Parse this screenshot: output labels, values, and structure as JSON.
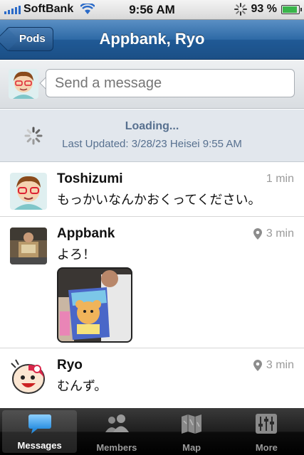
{
  "status_bar": {
    "carrier": "SoftBank",
    "time": "9:56 AM",
    "battery": "93 %",
    "battery_level": 0.93
  },
  "nav": {
    "back_label": "Pods",
    "title": "Appbank, Ryo"
  },
  "compose": {
    "placeholder": "Send a message"
  },
  "loading": {
    "title": "Loading...",
    "last_updated": "Last Updated: 3/28/23 Heisei 9:55 AM"
  },
  "feed": [
    {
      "name": "Toshizumi",
      "time": "1 min",
      "text": "もっかいなんかおくってください。",
      "has_location": false,
      "has_photo": false
    },
    {
      "name": "Appbank",
      "time": "3 min",
      "text": "よろ！",
      "has_location": true,
      "has_photo": true
    },
    {
      "name": "Ryo",
      "time": "3 min",
      "text": "むんず。",
      "has_location": true,
      "has_photo": false
    }
  ],
  "tabs": [
    {
      "label": "Messages",
      "icon": "speech-bubble-icon",
      "active": true
    },
    {
      "label": "Members",
      "icon": "people-icon",
      "active": false
    },
    {
      "label": "Map",
      "icon": "map-icon",
      "active": false
    },
    {
      "label": "More",
      "icon": "sliders-icon",
      "active": false
    }
  ],
  "colors": {
    "nav_blue": "#1b4f86",
    "accent": "#57708f",
    "active_tab": "#4aa3e8"
  }
}
